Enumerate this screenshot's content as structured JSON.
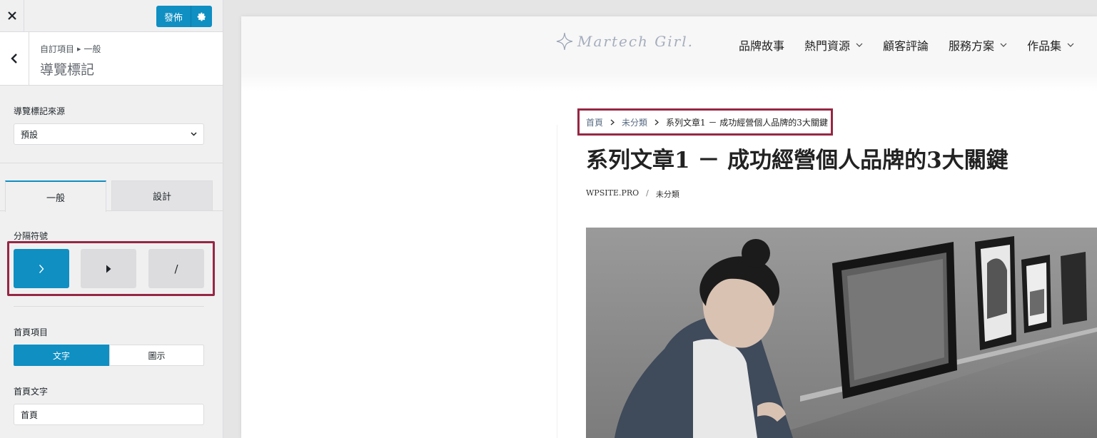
{
  "topbar": {
    "publish_label": "發佈"
  },
  "section": {
    "breadcrumb_parent": "自訂項目",
    "breadcrumb_child": "一般",
    "title": "導覽標記"
  },
  "controls": {
    "source_label": "導覽標記來源",
    "source_value": "預設",
    "tabs": [
      {
        "label": "一般"
      },
      {
        "label": "設計"
      }
    ],
    "separator_label": "分隔符號",
    "separators": [
      {
        "glyph": "›",
        "selected": true
      },
      {
        "glyph": "▸",
        "selected": false
      },
      {
        "glyph": "/",
        "selected": false
      }
    ],
    "home_item_label": "首頁項目",
    "home_item_options": [
      {
        "label": "文字",
        "selected": true
      },
      {
        "label": "圖示",
        "selected": false
      }
    ],
    "home_text_label": "首頁文字",
    "home_text_value": "首頁"
  },
  "site": {
    "logo_text": "Martech Girl.",
    "nav": [
      {
        "label": "品牌故事",
        "has_dropdown": false
      },
      {
        "label": "熱門資源",
        "has_dropdown": true
      },
      {
        "label": "顧客評論",
        "has_dropdown": false
      },
      {
        "label": "服務方案",
        "has_dropdown": true
      },
      {
        "label": "作品集",
        "has_dropdown": true
      }
    ]
  },
  "post": {
    "breadcrumb": {
      "home": "首頁",
      "category": "未分類",
      "current": "系列文章1 － 成功經營個人品牌的3大關鍵"
    },
    "title": "系列文章1 － 成功經營個人品牌的3大關鍵",
    "meta_author": "WPSITE.PRO",
    "meta_category": "未分類"
  },
  "colors": {
    "accent": "#0f8fc2",
    "highlight": "#962743"
  }
}
